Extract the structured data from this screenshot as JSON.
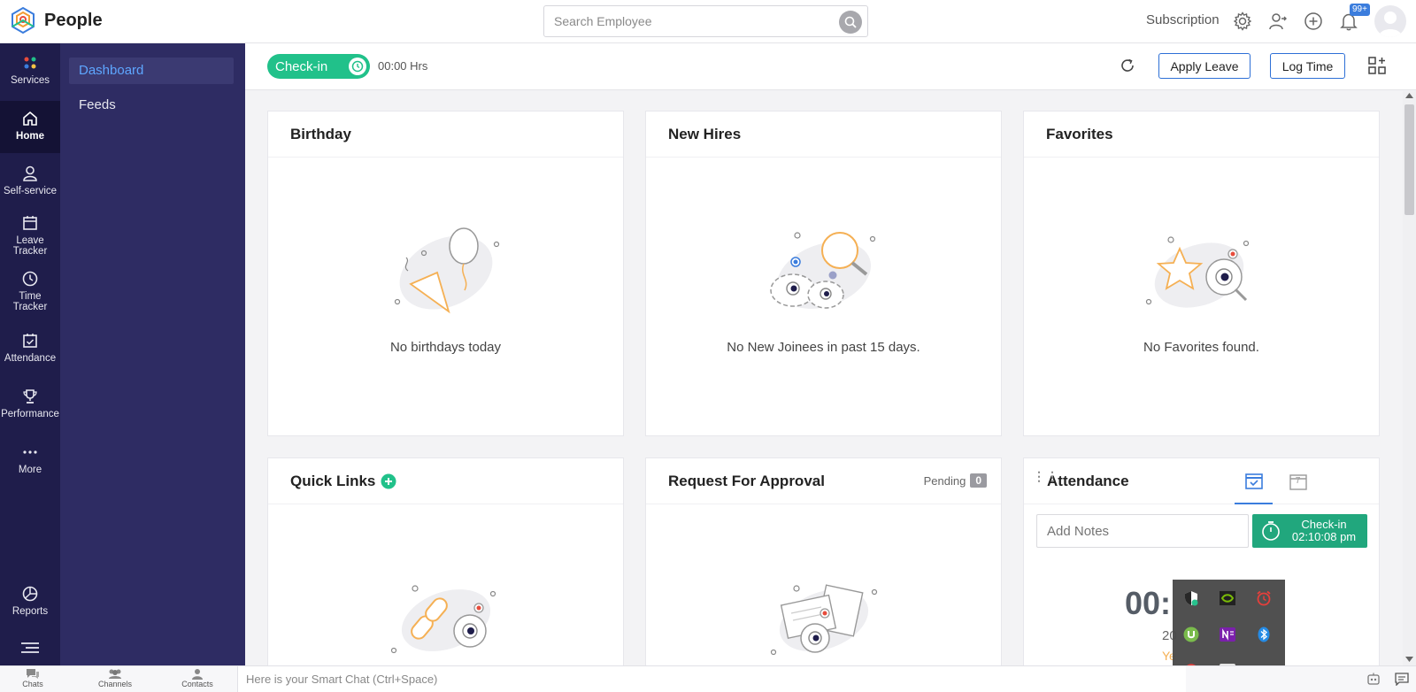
{
  "header": {
    "app_name": "People",
    "search_placeholder": "Search Employee",
    "subscription_label": "Subscription",
    "notification_count": "99+"
  },
  "rail": {
    "items": [
      {
        "label": "Services",
        "icon": "services-dots-icon"
      },
      {
        "label": "Home",
        "icon": "home-icon"
      },
      {
        "label": "Self-service",
        "icon": "user-icon"
      },
      {
        "label": "Leave Tracker",
        "icon": "calendar-icon"
      },
      {
        "label": "Time Tracker",
        "icon": "clock-icon"
      },
      {
        "label": "Attendance",
        "icon": "calendar-check-icon"
      },
      {
        "label": "Performance",
        "icon": "trophy-icon"
      },
      {
        "label": "More",
        "icon": "more-dots-icon"
      },
      {
        "label": "Reports",
        "icon": "pie-chart-icon"
      }
    ]
  },
  "submenu": {
    "items": [
      {
        "label": "Dashboard"
      },
      {
        "label": "Feeds"
      }
    ]
  },
  "actionbar": {
    "checkin_label": "Check-in",
    "hours": "00:00 Hrs",
    "apply_leave": "Apply Leave",
    "log_time": "Log Time"
  },
  "cards": {
    "birthday": {
      "title": "Birthday",
      "empty": "No birthdays today"
    },
    "new_hires": {
      "title": "New Hires",
      "empty": "No New Joinees in past 15 days."
    },
    "favorites": {
      "title": "Favorites",
      "empty": "No Favorites found."
    },
    "quick_links": {
      "title": "Quick Links"
    },
    "request_approval": {
      "title": "Request For Approval",
      "pending_label": "Pending",
      "pending_count": "0"
    },
    "attendance": {
      "title": "Attendance",
      "week_tab_number": "7",
      "notes_placeholder": "Add Notes",
      "checkin_label": "Check-in",
      "checkin_time": "02:10:08 pm",
      "timer_partial": "00:",
      "date_partial": "20",
      "status_partial": "Ye"
    }
  },
  "bottombar": {
    "chats": "Chats",
    "channels": "Channels",
    "contacts": "Contacts",
    "smartchat_placeholder": "Here is your Smart Chat (Ctrl+Space)"
  },
  "colors": {
    "rail_bg": "#1f1d4b",
    "submenu_bg": "#2e2c63",
    "accent_green": "#21c18a",
    "link_blue": "#2d6fd6"
  }
}
